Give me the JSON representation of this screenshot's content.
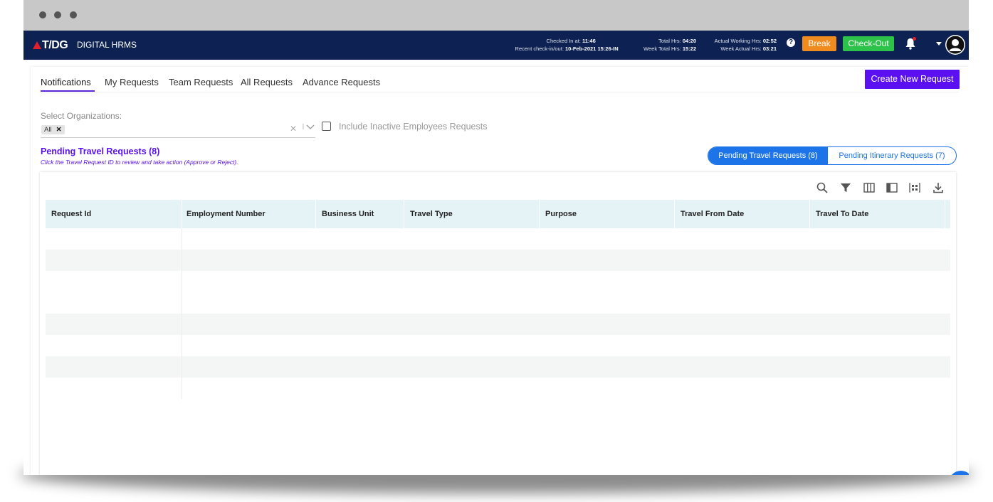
{
  "header": {
    "logo": "T/DG",
    "brand": "DIGITAL HRMS",
    "checked_in_label": "Checked In at:",
    "checked_in_value": "11:46",
    "recent_label": "Recent check-in/out:",
    "recent_value": "10-Feb-2021 15:26-IN",
    "total_hrs_label": "Total Hrs:",
    "total_hrs_value": "04:20",
    "week_total_label": "Week Total Hrs:",
    "week_total_value": "15:22",
    "actual_working_label": "Actual Working Hrs:",
    "actual_working_value": "02:52",
    "week_actual_label": "Week Actual Hrs:",
    "week_actual_value": "03:21",
    "help": "?",
    "break_label": "Break",
    "checkout_label": "Check-Out",
    "colors": {
      "topbar": "#0d2152",
      "break": "#f08c1f",
      "checkout": "#2dc24a"
    }
  },
  "tabs": [
    "Notifications",
    "My Requests",
    "Team Requests",
    "All Requests",
    "Advance Requests"
  ],
  "active_tab": "Notifications",
  "create_button": "Create New Request",
  "filters": {
    "org_label": "Select Organizations:",
    "org_chip": "All",
    "include_inactive_label": "Include Inactive Employees Requests",
    "include_inactive_checked": false
  },
  "section": {
    "title": "Pending Travel Requests (8)",
    "subtitle": "Click the Travel Request ID to review and take action (Approve or Reject)."
  },
  "toggle": {
    "active": "Pending Travel Requests (8)",
    "inactive": "Pending Itinerary Requests (7)"
  },
  "toolbar_icons": [
    "search-icon",
    "filter-icon",
    "columns-icon",
    "panel-icon",
    "density-icon",
    "download-icon"
  ],
  "table": {
    "columns": [
      "Request Id",
      "Employment Number",
      "Business Unit",
      "Travel Type",
      "Purpose",
      "Travel From Date",
      "Travel To Date"
    ],
    "rows": 8
  },
  "accent_color": "#5a10f0"
}
